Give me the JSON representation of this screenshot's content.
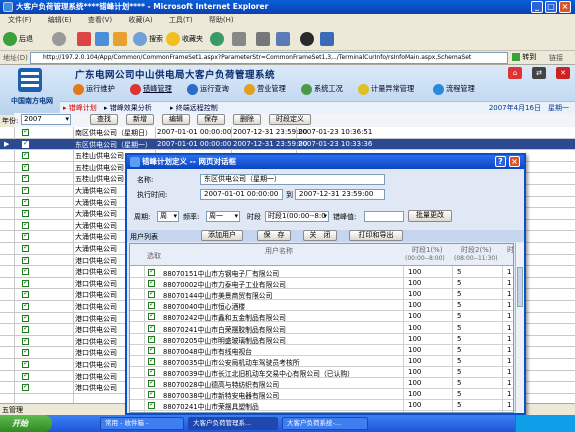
{
  "window": {
    "title": "大客户负荷管理系统****错峰计划**** - Microsoft Internet Explorer",
    "minimize": "_",
    "maximize": "□",
    "close": "×"
  },
  "menu": [
    "文件(F)",
    "编辑(E)",
    "查看(V)",
    "收藏(A)",
    "工具(T)",
    "帮助(H)"
  ],
  "toolbar": {
    "back": "后退",
    "search": "搜索",
    "favorites": "收藏夹"
  },
  "address": {
    "label": "地址(D)",
    "url": "http://197.2.0.104/App/Common/CommonFrameSet1.aspx?ParameterStr=CommonFrameSet1,3,../TerminalCurInfo/rsInfoMain.aspx,SchemaSet",
    "go": "转到",
    "links": "链接"
  },
  "header": {
    "logo_text": "中国南方电网",
    "system_title": "广东电网公司中山供电局大客户负荷管理系统",
    "nav": [
      "运行维护",
      "错峰管理",
      "运行查询",
      "营业管理",
      "系统工况",
      "计量异常管理",
      "流程管理"
    ],
    "subnav": [
      "错峰计划",
      "错峰效果分析",
      "终端远程控制"
    ],
    "date": "2007年4月16日　星期一"
  },
  "grid_toolbar": {
    "year_label": "年份:",
    "year_value": "2007",
    "buttons": [
      "查找",
      "新增",
      "编辑",
      "保存",
      "删除",
      "时段定义"
    ]
  },
  "grid_rows": [
    {
      "name": "南区供电公司（星期日）",
      "start": "2007-01-01 00:00:00",
      "end": "2007-12-31 23:59:00",
      "updated": "2007-01-23 10:36:51"
    },
    {
      "name": "东区供电公司（星期一）",
      "start": "2007-01-01 00:00:00",
      "end": "2007-12-31 23:59:00",
      "updated": "2007-01-23 10:33:36",
      "selected": true
    },
    {
      "name": "五桂山供电公司",
      "start": "",
      "end": "",
      "updated": ""
    },
    {
      "name": "五桂山供电公司",
      "start": "",
      "end": "",
      "updated": ""
    },
    {
      "name": "五桂山供电公司",
      "start": "",
      "end": "",
      "updated": ""
    },
    {
      "name": "大涌供电公司",
      "start": "",
      "end": "",
      "updated": ""
    },
    {
      "name": "大涌供电公司",
      "start": "",
      "end": "",
      "updated": ""
    },
    {
      "name": "大涌供电公司",
      "start": "",
      "end": "",
      "updated": ""
    },
    {
      "name": "大涌供电公司",
      "start": "",
      "end": "",
      "updated": ""
    },
    {
      "name": "大涌供电公司",
      "start": "",
      "end": "",
      "updated": ""
    },
    {
      "name": "大涌供电公司",
      "start": "",
      "end": "",
      "updated": ""
    },
    {
      "name": "港口供电公司",
      "start": "",
      "end": "",
      "updated": ""
    },
    {
      "name": "港口供电公司",
      "start": "",
      "end": "",
      "updated": ""
    },
    {
      "name": "港口供电公司",
      "start": "",
      "end": "",
      "updated": ""
    },
    {
      "name": "港口供电公司",
      "start": "",
      "end": "",
      "updated": ""
    },
    {
      "name": "港口供电公司",
      "start": "",
      "end": "",
      "updated": ""
    },
    {
      "name": "港口供电公司",
      "start": "",
      "end": "",
      "updated": ""
    },
    {
      "name": "港口供电公司",
      "start": "",
      "end": "",
      "updated": ""
    },
    {
      "name": "港口供电公司",
      "start": "",
      "end": "",
      "updated": ""
    },
    {
      "name": "港口供电公司",
      "start": "",
      "end": "",
      "updated": ""
    },
    {
      "name": "港口供电公司",
      "start": "",
      "end": "",
      "updated": ""
    },
    {
      "name": "港口供电公司",
      "start": "",
      "end": "",
      "updated": ""
    },
    {
      "name": "港口供电公司",
      "start": "",
      "end": "",
      "updated": ""
    }
  ],
  "bottom_tab": "五管理",
  "dialog": {
    "title": "错峰计划定义 -- 网页对话框",
    "help": "?",
    "close": "×",
    "name_label": "名称:",
    "name_value": "东区供电公司（星期一）",
    "exec_label": "执行时间:",
    "exec_start": "2007-01-01 00:00:00",
    "exec_to": "到",
    "exec_end": "2007-12-31 23:59:00",
    "period_label": "周期:",
    "period_value": "周",
    "freq_label": "频率:",
    "freq_value": "周一",
    "slot_label": "时段",
    "slot_value": "时段1(00:00--8:0",
    "cut_label": "错峰值:",
    "cut_value": "",
    "batch_btn": "批量更改",
    "userlist_label": "用户列表",
    "add_btn": "添加用户",
    "save_btn": "保　存",
    "close_btn": "关　闭",
    "print_btn": "打印和导出",
    "table_headers": {
      "select": "选取",
      "username": "用户名称",
      "slot1": "时段1(%)",
      "slot1_range": "(00:00--8:00)",
      "slot2": "时段2(%)",
      "slot2_range": "(08:00--11:30)",
      "slot3": "时"
    },
    "users": [
      {
        "name": "88070151中山市方钢电子厂有限公司",
        "v1": "100",
        "v2": "5",
        "v3": "1"
      },
      {
        "name": "88070002中山市力泰电子工业有限公司",
        "v1": "100",
        "v2": "5",
        "v3": "1"
      },
      {
        "name": "88070144中山市美景商贸有限公司",
        "v1": "100",
        "v2": "5",
        "v3": "1"
      },
      {
        "name": "88070040中山市恒心酒楼",
        "v1": "100",
        "v2": "5",
        "v3": "1"
      },
      {
        "name": "88070242中山市鑫和五金制品有限公司",
        "v1": "100",
        "v2": "5",
        "v3": "1"
      },
      {
        "name": "88070241中山市白荣摆胶制品有限公司",
        "v1": "100",
        "v2": "5",
        "v3": "1"
      },
      {
        "name": "88070205中山市明盛玻璃制品有限公司",
        "v1": "100",
        "v2": "5",
        "v3": "1"
      },
      {
        "name": "88070048中山市有线电视台",
        "v1": "100",
        "v2": "5",
        "v3": "1"
      },
      {
        "name": "88070035中山市公安局机动车驾驶员考核所",
        "v1": "100",
        "v2": "5",
        "v3": "1"
      },
      {
        "name": "88070039中山市长江北旧机动车交易中心有限公司（已认购）",
        "v1": "100",
        "v2": "5",
        "v3": "1"
      },
      {
        "name": "88070028中山德高与特纺织有限公司",
        "v1": "100",
        "v2": "5",
        "v3": "1"
      },
      {
        "name": "88070038中山市新特安电器有限公司",
        "v1": "100",
        "v2": "5",
        "v3": "1"
      },
      {
        "name": "88070241中山市荣摆具塑制品",
        "v1": "100",
        "v2": "5",
        "v3": "1"
      }
    ]
  },
  "taskbar": {
    "start": "开始",
    "tasks": [
      "常用 - 收件箱 -",
      "大客户负荷管理系...",
      "大客户负荷系统-..."
    ]
  },
  "colors": {
    "selected_row": "#2b4a92",
    "title_bar": "#0b45c0",
    "check": "#1e7b1e"
  }
}
